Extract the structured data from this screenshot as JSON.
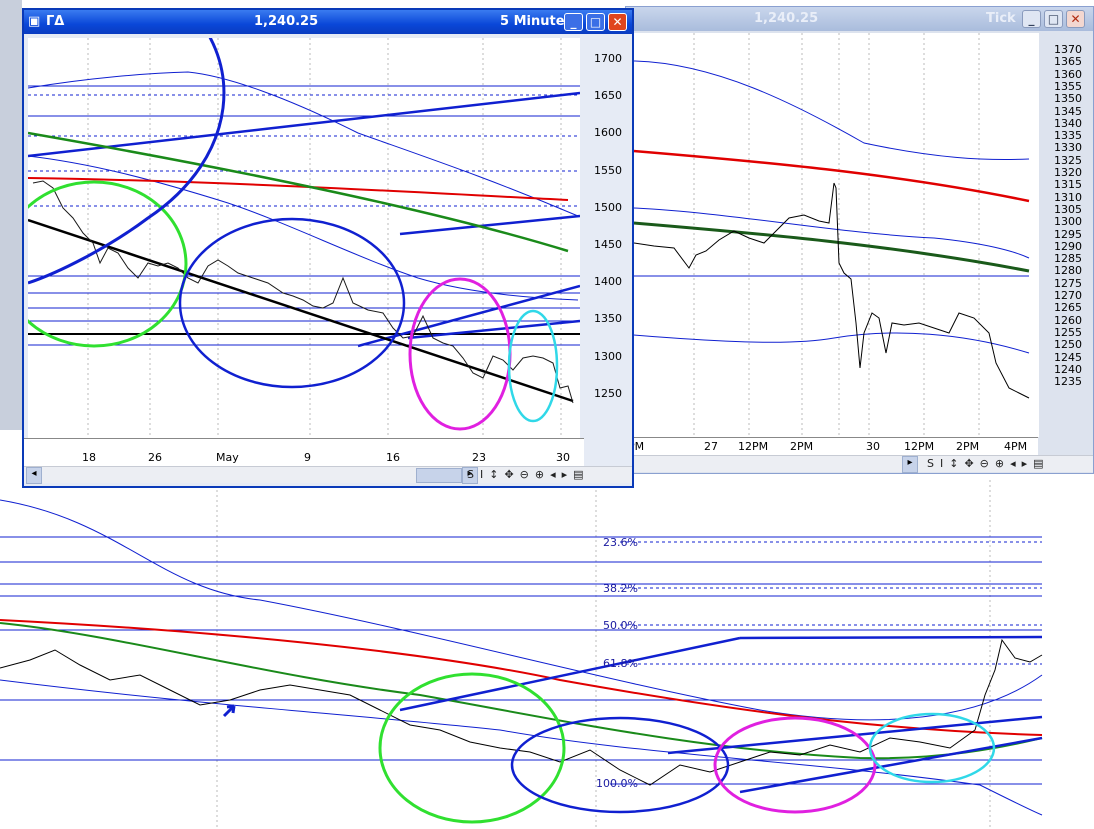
{
  "window_main": {
    "title_symbol": "ΓΔ",
    "title_price": "1,240.25",
    "title_interval": "5 Minute",
    "y_ticks": [
      "1700",
      "1650",
      "1600",
      "1550",
      "1500",
      "1450",
      "1400",
      "1350",
      "1300",
      "1250"
    ],
    "x_ticks": [
      "18",
      "26",
      "May",
      "9",
      "16",
      "23",
      "30"
    ],
    "toolbar_icons": [
      "S",
      "I",
      "↕",
      "✥",
      "⊖",
      "⊕",
      "◂",
      "▸",
      "▤"
    ]
  },
  "window_tick": {
    "title_price": "1,240.25",
    "title_interval": "Tick",
    "y_ticks": [
      "1370",
      "1365",
      "1360",
      "1355",
      "1350",
      "1345",
      "1340",
      "1335",
      "1330",
      "1325",
      "1320",
      "1315",
      "1310",
      "1305",
      "1300",
      "1295",
      "1290",
      "1285",
      "1280",
      "1275",
      "1270",
      "1265",
      "1260",
      "1255",
      "1250",
      "1245",
      "1240",
      "1235"
    ],
    "x_ticks": [
      "PM",
      "27",
      "12PM",
      "2PM",
      "30",
      "12PM",
      "2PM",
      "4PM"
    ],
    "toolbar_icons": [
      "S",
      "I",
      "↕",
      "✥",
      "⊖",
      "⊕",
      "◂",
      "▸",
      "▤"
    ]
  },
  "fib_labels": [
    "23.6%",
    "38.2%",
    "50.0%",
    "61.8%",
    "100.0%"
  ],
  "colors": {
    "red": "#e00000",
    "green": "#1a8a1a",
    "blue": "#1020d0",
    "magenta": "#e020e0",
    "cyan": "#30d8e8",
    "lime": "#30e030"
  }
}
